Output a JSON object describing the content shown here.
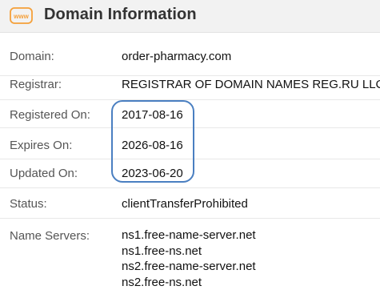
{
  "header": {
    "icon_text": "www",
    "title": "Domain Information"
  },
  "rows": [
    {
      "label": "Domain:",
      "value": "order-pharmacy.com"
    },
    {
      "label": "Registrar:",
      "value": "REGISTRAR OF DOMAIN NAMES REG.RU LLC"
    },
    {
      "label": "Registered On:",
      "value": "2017-08-16"
    },
    {
      "label": "Expires On:",
      "value": "2026-08-16"
    },
    {
      "label": "Updated On:",
      "value": "2023-06-20"
    },
    {
      "label": "Status:",
      "value": "clientTransferProhibited"
    }
  ],
  "name_servers": {
    "label": "Name Servers:",
    "items": [
      "ns1.free-name-server.net",
      "ns1.free-ns.net",
      "ns2.free-name-server.net",
      "ns2.free-ns.net"
    ]
  },
  "colors": {
    "accent": "#f5a03a",
    "highlight": "#4a7fc1",
    "header_bg": "#f2f2f2"
  }
}
